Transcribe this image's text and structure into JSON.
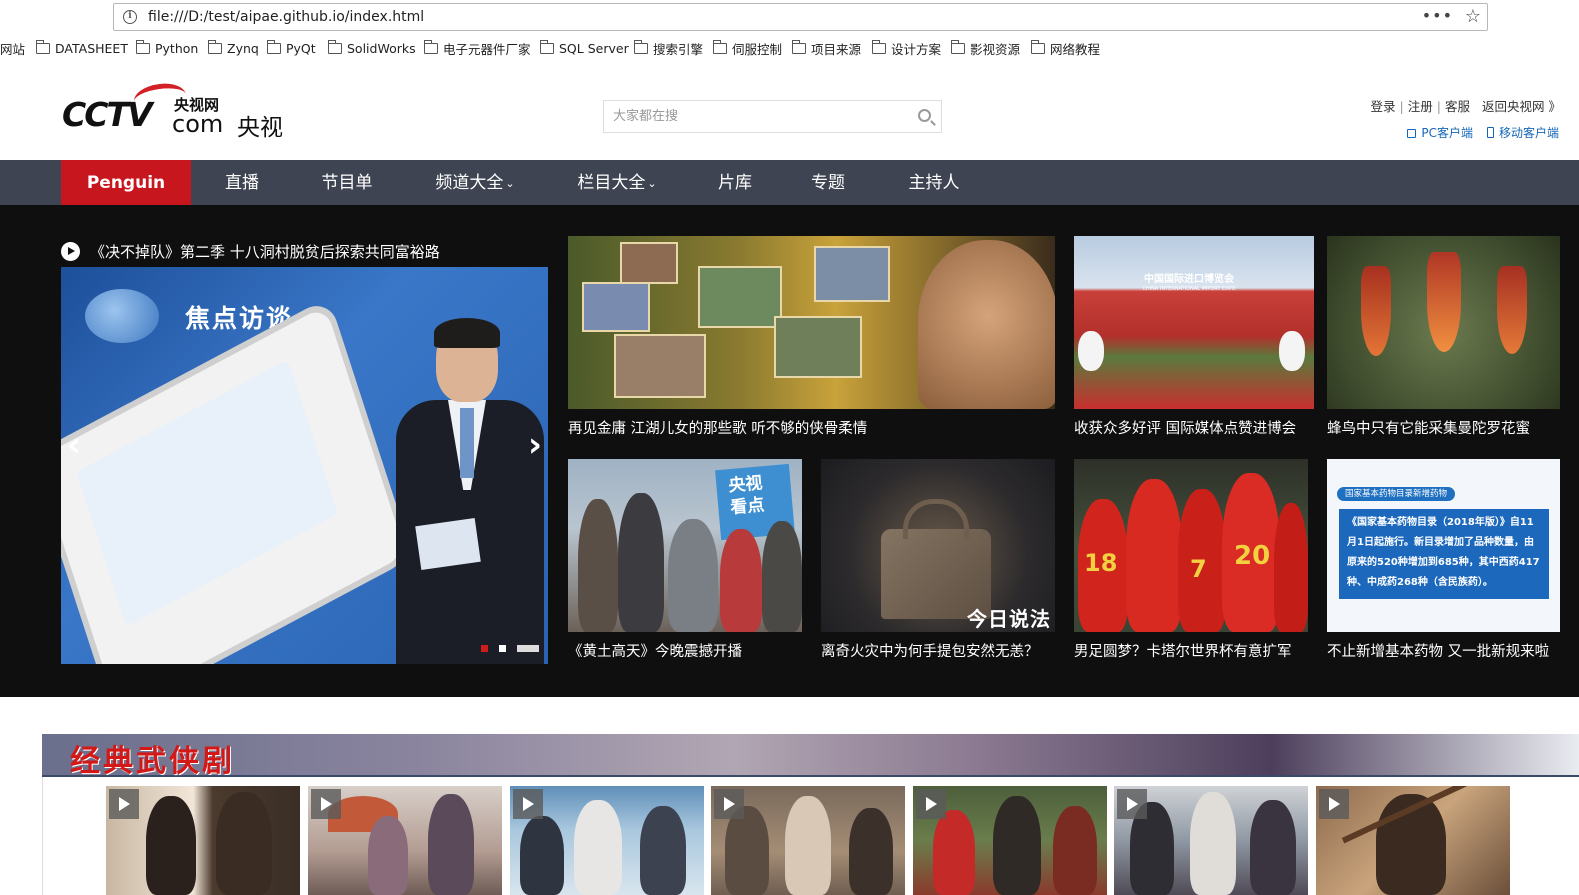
{
  "browser": {
    "url": "file:///D:/test/aipae.github.io/index.html",
    "more_glyph": "•••",
    "star_glyph": "☆",
    "info_glyph": "i"
  },
  "bookmarks": [
    "网站",
    "DATASHEET",
    "Python",
    "Zynq",
    "PyQt",
    "SolidWorks",
    "电子元器件厂家",
    "SQL Server",
    "搜索引擎",
    "伺服控制",
    "项目来源",
    "设计方案",
    "影视资源",
    "网络教程"
  ],
  "header": {
    "logo_cctv": "CCTV",
    "logo_ysw": "央视网",
    "logo_com": "com",
    "logo_ys": "央视",
    "search_placeholder": "大家都在搜",
    "login": "登录",
    "register": "注册",
    "service": "客服",
    "back": "返回央视网 》",
    "pc_client": "PC客户端",
    "mobile_client": "移动客户端"
  },
  "nav": {
    "items": [
      {
        "label": "Penguin",
        "active": true
      },
      {
        "label": "直播"
      },
      {
        "label": "节目单"
      },
      {
        "label": "频道大全",
        "dropdown": true
      },
      {
        "label": "栏目大全",
        "dropdown": true
      },
      {
        "label": "片库"
      },
      {
        "label": "专题"
      },
      {
        "label": "主持人"
      }
    ],
    "chevron": "⌄"
  },
  "feature": {
    "headline": "《决不掉队》第二季 十八洞村脱贫后探索共同富裕路",
    "slider_title": "焦点访谈",
    "prev_arrow": "‹",
    "next_arrow": "›",
    "tiles": [
      {
        "caption": "再见金庸 江湖儿女的那些歌 听不够的侠骨柔情"
      },
      {
        "caption": "收获众多好评 国际媒体点赞进博会"
      },
      {
        "caption": "蜂鸟中只有它能采集曼陀罗花蜜"
      },
      {
        "caption": "《黄土高天》今晚震撼开播"
      },
      {
        "caption": "离奇火灾中为何手提包安然无恙？"
      },
      {
        "caption": "男足圆梦？卡塔尔世界杯有意扩军"
      },
      {
        "caption": "不止新增基本药物 又一批新规来啦"
      }
    ],
    "expo_sign": "中国国际进口博览会",
    "expo_sub": "CHINA INTERNATIONAL IMPORT EXPO",
    "kandian": "央视\n看点",
    "jrsf": "今日说法",
    "jersey_a": "18",
    "jersey_b": "7",
    "jersey_c": "20",
    "drug_tag": "国家基本药物目录新增药物",
    "drug_text": "《国家基本药物目录（2018年版）》自11月1日起施行。新目录增加了品种数量，由原来的520种增加到685种，其中西药417种、中成药268种（含民族药）。"
  },
  "section": {
    "title": "经典武侠剧"
  },
  "colors": {
    "nav_bg": "#3e4452",
    "nav_active": "#c7161d",
    "feature_bg": "#0f0f0f",
    "link_blue": "#1566b8"
  }
}
